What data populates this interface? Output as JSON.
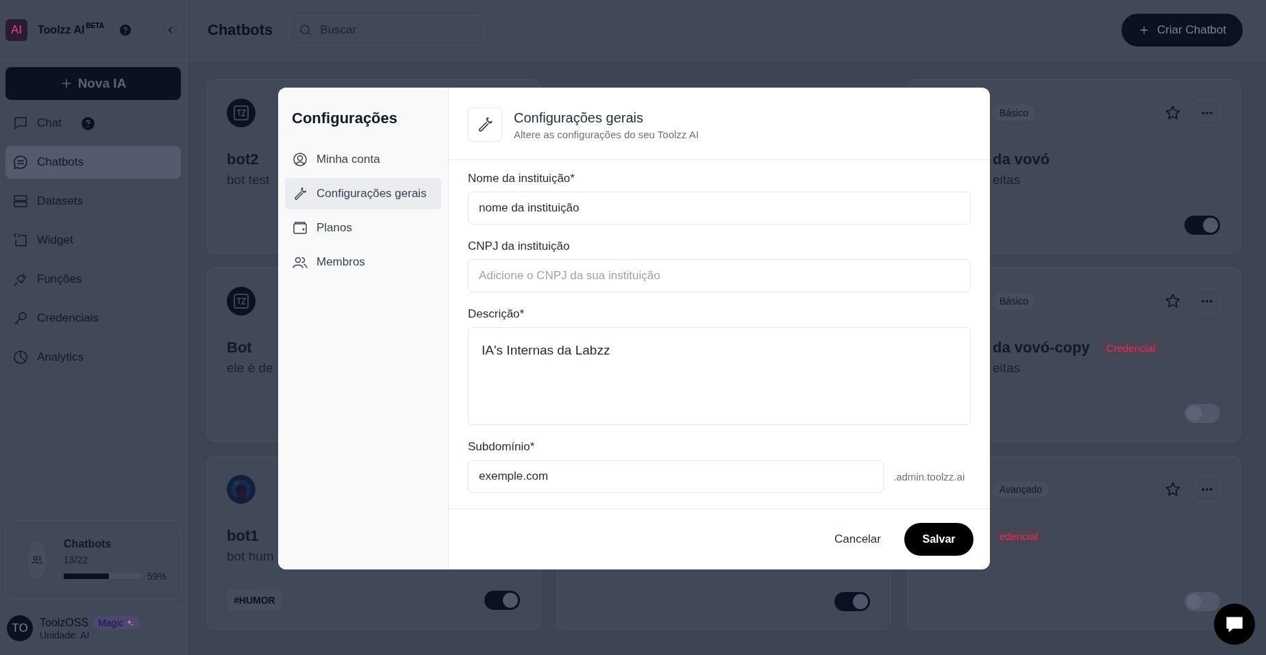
{
  "sidebar": {
    "logo": "AI",
    "brand": "Toolzz AI",
    "brand_badge": "BETA",
    "new_button": "Nova IA",
    "items": [
      {
        "label": "Chat",
        "kind": "chat",
        "selected": false,
        "help": true
      },
      {
        "label": "Chatbots",
        "kind": "chatbots",
        "selected": true,
        "help": false
      },
      {
        "label": "Datasets",
        "kind": "datasets",
        "selected": false,
        "help": false
      },
      {
        "label": "Widget",
        "kind": "widget",
        "selected": false,
        "help": false
      },
      {
        "label": "Funções",
        "kind": "functions",
        "selected": false,
        "help": false
      },
      {
        "label": "Credenciais",
        "kind": "credentials",
        "selected": false,
        "help": false
      },
      {
        "label": "Analytics",
        "kind": "analytics",
        "selected": false,
        "help": false
      }
    ],
    "usage": {
      "title": "Chatbots",
      "count": "13/22",
      "level": 0.59,
      "percent": "59%"
    },
    "user": {
      "initials": "TO",
      "name": "ToolzOSS",
      "badge": "Magic",
      "unit": "Unidade: AI"
    }
  },
  "header": {
    "title": "Chatbots",
    "search": {
      "placeholder": "Buscar"
    },
    "create_button": "Criar Chatbot"
  },
  "card_columns": [
    {
      "cards": [
        {
          "avatar": {
            "kind": "logo"
          },
          "name": "bot2",
          "description": "bot test"
        },
        {
          "avatar": {
            "kind": "logo"
          },
          "name": "Bot",
          "description": "ele é de"
        },
        {
          "name": "bot1",
          "description": "bot hum",
          "hashtag": "#HUMOR",
          "on": true
        }
      ]
    },
    {
      "cards": [
        {
          "on": true
        }
      ]
    },
    {
      "cards": [
        {
          "tag": "Básico",
          "name": "da vovó",
          "description": "eitas",
          "on": true
        },
        {
          "tag": "Básico",
          "name": "da vovó-copy",
          "badge": "Credencial",
          "description": "eitas",
          "on": false
        },
        {
          "tag": "Avançado",
          "badge": "edencial",
          "on": false
        }
      ]
    }
  ],
  "modal": {
    "title": "Configurações",
    "nav": [
      {
        "label": "Minha conta",
        "kind": "account",
        "selected": false
      },
      {
        "label": "Configurações gerais",
        "kind": "wrench",
        "selected": true
      },
      {
        "label": "Planos",
        "kind": "wallet",
        "selected": false
      },
      {
        "label": "Membros",
        "kind": "members",
        "selected": false
      }
    ],
    "section_title": "Configurações gerais",
    "section_subtitle": "Altere as configurações do seu Toolzz AI",
    "fields": [
      {
        "kind": "input",
        "label": "Nome da instituição*",
        "value": "nome da instituição"
      },
      {
        "kind": "input",
        "label": "CNPJ da instituição",
        "placeholder": "Adicione o CNPJ da sua instituição"
      },
      {
        "kind": "textarea",
        "label": "Descrição*",
        "value": "IA's Internas da Labzz"
      },
      {
        "kind": "input",
        "label": "Subdomínio*",
        "value": "exemple.com",
        "suffix": ".admin.toolzz.ai"
      }
    ],
    "cancel": "Cancelar",
    "save": "Salvar"
  }
}
